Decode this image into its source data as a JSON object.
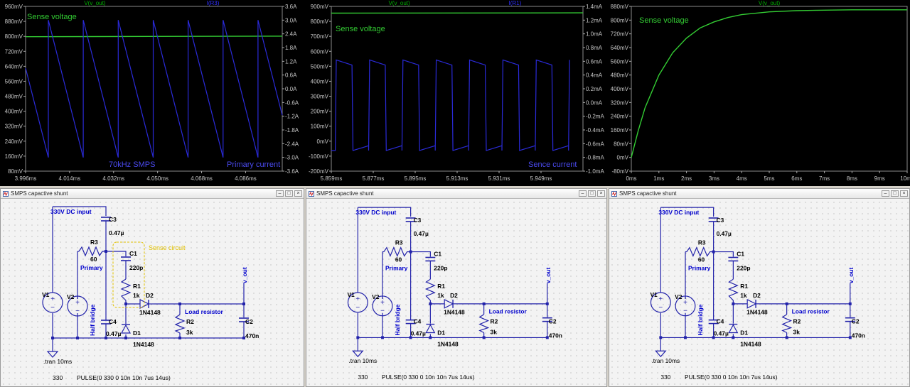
{
  "colors": {
    "plot_bg": "#000000",
    "grid": "#3a3a3a",
    "axis_text": "#c8c8c8",
    "green_trace": "#33cc33",
    "blue_trace": "#2a2ad8",
    "wire": "#2222aa",
    "label_blue": "#0000cc",
    "label_yellow": "#e0c000",
    "tick_green": "#00b000",
    "tick_blue": "#3030ff"
  },
  "icons": [
    "ltspice-window-icon",
    "minimize-icon",
    "maximize-icon",
    "close-icon",
    "voltage-source-icon",
    "ground-icon",
    "diode-icon"
  ],
  "plots": [
    {
      "id": "plot1",
      "trace_labels": [
        "V(v_out)",
        "I(R3)"
      ],
      "left_ticks": [
        "960mV",
        "880mV",
        "800mV",
        "720mV",
        "640mV",
        "560mV",
        "480mV",
        "400mV",
        "320mV",
        "240mV",
        "160mV",
        "80mV"
      ],
      "right_ticks": [
        "3.6A",
        "3.0A",
        "2.4A",
        "1.8A",
        "1.2A",
        "0.6A",
        "0.0A",
        "-0.6A",
        "-1.2A",
        "-1.8A",
        "-2.4A",
        "-3.0A",
        "-3.6A"
      ],
      "x_ticks": [
        "3.996ms",
        "4.014ms",
        "4.032ms",
        "4.050ms",
        "4.068ms",
        "4.086ms"
      ],
      "annotations": [
        "Sense voltage",
        "70kHz SMPS",
        "Primary current"
      ]
    },
    {
      "id": "plot2",
      "trace_labels": [
        "V(v_out)",
        "I(R1)"
      ],
      "left_ticks": [
        "900mV",
        "800mV",
        "700mV",
        "600mV",
        "500mV",
        "400mV",
        "300mV",
        "200mV",
        "100mV",
        "0mV",
        "-100mV",
        "-200mV"
      ],
      "right_ticks": [
        "1.4mA",
        "1.2mA",
        "1.0mA",
        "0.8mA",
        "0.6mA",
        "0.4mA",
        "0.2mA",
        "0.0mA",
        "-0.2mA",
        "-0.4mA",
        "-0.6mA",
        "-0.8mA",
        "-1.0mA"
      ],
      "x_ticks": [
        "5.859ms",
        "5.877ms",
        "5.895ms",
        "5.913ms",
        "5.931ms",
        "5.949ms"
      ],
      "annotations": [
        "Sense voltage",
        "Sence current"
      ]
    },
    {
      "id": "plot3",
      "trace_labels": [
        "V(v_out)"
      ],
      "left_ticks": [
        "880mV",
        "800mV",
        "720mV",
        "640mV",
        "560mV",
        "480mV",
        "400mV",
        "320mV",
        "240mV",
        "160mV",
        "80mV",
        "0mV",
        "-80mV"
      ],
      "x_ticks": [
        "0ms",
        "1ms",
        "2ms",
        "3ms",
        "4ms",
        "5ms",
        "6ms",
        "7ms",
        "8ms",
        "9ms",
        "10ms"
      ],
      "annotations": [
        "Sense voltage"
      ]
    }
  ],
  "chart_data": [
    {
      "type": "line",
      "title": "",
      "x_range_ms": [
        3.996,
        4.101
      ],
      "series": [
        {
          "name": "V(v_out)",
          "axis": "left",
          "unit": "mV",
          "x": [
            3.996,
            4.101
          ],
          "y": [
            798,
            801
          ]
        },
        {
          "name": "I(R3)",
          "axis": "right",
          "unit": "A",
          "shape": "sawtooth",
          "period_ms": 0.0143,
          "low": -3.0,
          "high": 3.0,
          "start_x": 3.996
        }
      ],
      "ylim_left": [
        80,
        960
      ],
      "ylim_right": [
        -3.6,
        3.6
      ],
      "grid": false
    },
    {
      "type": "line",
      "title": "",
      "x_range_ms": [
        5.859,
        5.967
      ],
      "series": [
        {
          "name": "V(v_out)",
          "axis": "left",
          "unit": "mV",
          "x": [
            5.859,
            5.967
          ],
          "y": [
            855,
            857
          ]
        },
        {
          "name": "I(R1)",
          "axis": "right",
          "unit": "mA",
          "shape": "pulse",
          "period_ms": 0.0143,
          "low": -0.7,
          "high": 0.62,
          "start_x": 5.859
        }
      ],
      "ylim_left": [
        -200,
        900
      ],
      "ylim_right": [
        -1.0,
        1.4
      ],
      "grid": false
    },
    {
      "type": "line",
      "title": "",
      "x_range_ms": [
        0,
        10
      ],
      "series": [
        {
          "name": "V(v_out)",
          "axis": "left",
          "unit": "mV",
          "x": [
            0,
            0.25,
            0.5,
            1,
            1.5,
            2,
            2.5,
            3,
            3.5,
            4,
            5,
            6,
            7,
            8,
            9,
            10
          ],
          "y": [
            0,
            155,
            290,
            480,
            610,
            695,
            755,
            790,
            815,
            832,
            848,
            855,
            858,
            860,
            860,
            860
          ]
        }
      ],
      "ylim_left": [
        -80,
        880
      ],
      "grid": false
    }
  ],
  "windows": [
    {
      "title": "SMPS capactive shunt",
      "show_sense": true
    },
    {
      "title": "SMPS capactive shunt",
      "show_sense": false
    },
    {
      "title": "SMPS capactive shunt",
      "show_sense": false
    }
  ],
  "schematic": {
    "dc_input": "330V DC input",
    "c3": "C3",
    "c3_val": "0.47µ",
    "r3": "R3",
    "r3_val": "60",
    "primary": "Primary",
    "c1": "C1",
    "c1_val": "220p",
    "r1": "R1",
    "r1_val": "1k",
    "d2": "D2",
    "d2_model": "1N4148",
    "d1": "D1",
    "d1_model": "1N4148",
    "c4": "C4",
    "c4_val": "0.47µ",
    "v1": "V1",
    "v2": "V2",
    "half_bridge": "Half bridge",
    "load_resistor": "Load resistor",
    "r2": "R2",
    "r2_val": "3k",
    "c2": "C2",
    "c2_val": "470n",
    "vout": "v_out",
    "tran": ".tran 10ms",
    "v1_val": "330",
    "pulse": "PULSE(0 330 0 10n 10n 7us 14us)",
    "sense_circuit": "Sense circuit"
  },
  "window_buttons": {
    "minimize": "–",
    "maximize": "□",
    "close": "×"
  }
}
